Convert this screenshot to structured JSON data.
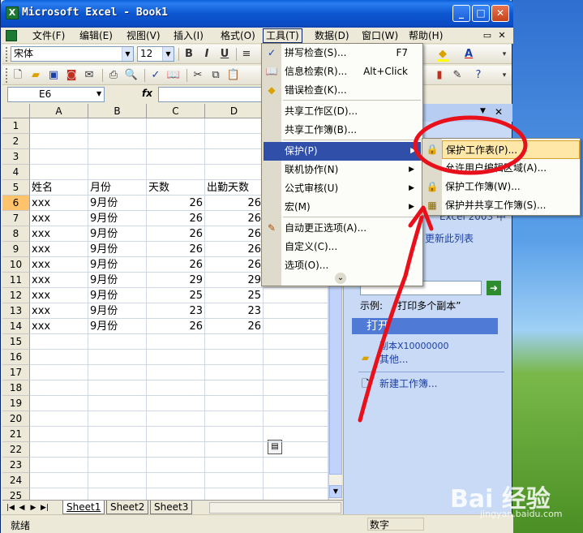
{
  "window": {
    "title": "Microsoft Excel - Book1",
    "app_icon_letter": "X",
    "btn_min": "_",
    "btn_max": "□",
    "btn_close": "✕"
  },
  "menubar": {
    "items": [
      "文件(F)",
      "编辑(E)",
      "视图(V)",
      "插入(I)",
      "格式(O)",
      "工具(T)",
      "数据(D)",
      "窗口(W)",
      "帮助(H)"
    ],
    "mdi_restore": "▭",
    "mdi_close": "✕"
  },
  "format_toolbar": {
    "font": "宋体",
    "size": "12",
    "bold": "B",
    "italic": "I",
    "underline": "U"
  },
  "standard_toolbar": {
    "icons": [
      "new-icon",
      "open-icon",
      "save-icon",
      "permission-icon",
      "print-icon",
      "print-preview-icon",
      "spelling-icon",
      "research-icon",
      "cut-icon",
      "copy-icon",
      "paste-icon"
    ]
  },
  "formula_bar": {
    "name_box": "E6",
    "fx": "fx"
  },
  "sheet": {
    "columns": [
      "A",
      "B",
      "C",
      "D"
    ],
    "rows": [
      {
        "n": "1",
        "a": "",
        "b": "",
        "c": "",
        "d": ""
      },
      {
        "n": "2",
        "a": "",
        "b": "",
        "c": "",
        "d": ""
      },
      {
        "n": "3",
        "a": "",
        "b": "",
        "c": "",
        "d": ""
      },
      {
        "n": "4",
        "a": "",
        "b": "",
        "c": "",
        "d": ""
      },
      {
        "n": "5",
        "a": "姓名",
        "b": "月份",
        "c": "天数",
        "d": "出勤天数"
      },
      {
        "n": "6",
        "a": "xxx",
        "b": "9月份",
        "c": "26",
        "d": "26"
      },
      {
        "n": "7",
        "a": "xxx",
        "b": "9月份",
        "c": "26",
        "d": "26"
      },
      {
        "n": "8",
        "a": "xxx",
        "b": "9月份",
        "c": "26",
        "d": "26"
      },
      {
        "n": "9",
        "a": "xxx",
        "b": "9月份",
        "c": "26",
        "d": "26"
      },
      {
        "n": "10",
        "a": "xxx",
        "b": "9月份",
        "c": "26",
        "d": "26"
      },
      {
        "n": "11",
        "a": "xxx",
        "b": "9月份",
        "c": "29",
        "d": "29"
      },
      {
        "n": "12",
        "a": "xxx",
        "b": "9月份",
        "c": "25",
        "d": "25"
      },
      {
        "n": "13",
        "a": "xxx",
        "b": "9月份",
        "c": "23",
        "d": "23"
      },
      {
        "n": "14",
        "a": "xxx",
        "b": "9月份",
        "c": "26",
        "d": "26"
      },
      {
        "n": "15",
        "a": "",
        "b": "",
        "c": "",
        "d": ""
      },
      {
        "n": "16",
        "a": "",
        "b": "",
        "c": "",
        "d": ""
      },
      {
        "n": "17",
        "a": "",
        "b": "",
        "c": "",
        "d": ""
      },
      {
        "n": "18",
        "a": "",
        "b": "",
        "c": "",
        "d": ""
      },
      {
        "n": "19",
        "a": "",
        "b": "",
        "c": "",
        "d": ""
      },
      {
        "n": "20",
        "a": "",
        "b": "",
        "c": "",
        "d": ""
      },
      {
        "n": "21",
        "a": "",
        "b": "",
        "c": "",
        "d": ""
      },
      {
        "n": "22",
        "a": "",
        "b": "",
        "c": "",
        "d": ""
      },
      {
        "n": "23",
        "a": "",
        "b": "",
        "c": "",
        "d": ""
      },
      {
        "n": "24",
        "a": "",
        "b": "",
        "c": "",
        "d": ""
      },
      {
        "n": "25",
        "a": "",
        "b": "",
        "c": "",
        "d": ""
      }
    ],
    "tabs": [
      "Sheet1",
      "Sheet2",
      "Sheet3"
    ]
  },
  "tools_menu": {
    "items": [
      {
        "label": "拼写检查(S)...",
        "shortcut": "F7",
        "icon": "spelling-icon"
      },
      {
        "label": "信息检索(R)...",
        "shortcut": "Alt+Click",
        "icon": "research-icon"
      },
      {
        "label": "错误检查(K)...",
        "shortcut": "",
        "icon": "error-check-icon"
      },
      {
        "label": "共享工作区(D)...",
        "shortcut": "",
        "icon": ""
      },
      {
        "label": "共享工作簿(B)...",
        "shortcut": "",
        "icon": ""
      },
      {
        "label": "保护(P)",
        "shortcut": "",
        "icon": ""
      },
      {
        "label": "联机协作(N)",
        "shortcut": "",
        "icon": ""
      },
      {
        "label": "公式审核(U)",
        "shortcut": "",
        "icon": ""
      },
      {
        "label": "宏(M)",
        "shortcut": "",
        "icon": ""
      },
      {
        "label": "自动更正选项(A)...",
        "shortcut": "",
        "icon": "autocorrect-icon"
      },
      {
        "label": "自定义(C)...",
        "shortcut": "",
        "icon": ""
      },
      {
        "label": "选项(O)...",
        "shortcut": "",
        "icon": ""
      }
    ],
    "expand": "⌄"
  },
  "protect_submenu": {
    "items": [
      {
        "label": "保护工作表(P)...",
        "icon": "protect-sheet-icon"
      },
      {
        "label": "允许用户编辑区域(A)...",
        "icon": ""
      },
      {
        "label": "保护工作簿(W)...",
        "icon": "protect-workbook-icon"
      },
      {
        "label": "保护并共享工作簿(S)...",
        "icon": "protect-share-icon"
      }
    ]
  },
  "taskpane": {
    "partial_text": "Excel 2003 中",
    "update_link": "更新此列表",
    "example_label": "示例:",
    "example_text": "“打印多个副本”",
    "open_title": "打开",
    "recent_file": "副本X10000000",
    "more_link": "其他...",
    "new_workbook": "新建工作簿..."
  },
  "status_bar": {
    "ready": "就绪",
    "num": "数字"
  },
  "watermark": {
    "logo": "Bai 经验",
    "url": "jingyan.baidu.com"
  },
  "colors": {
    "menu_highlight": "#2f4fa9",
    "annotation": "#e8101a",
    "selection_header": "#ffc46b"
  }
}
